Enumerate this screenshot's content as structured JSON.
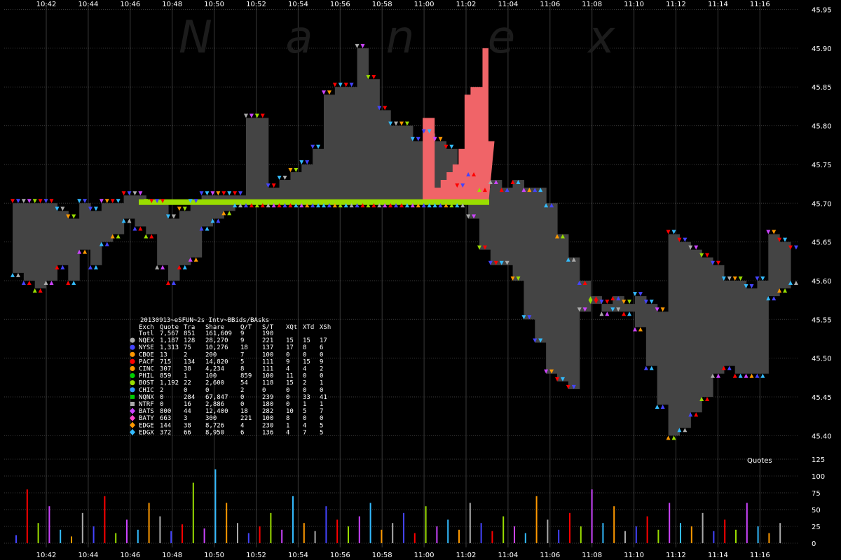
{
  "chart_data": {
    "type": "line",
    "watermark": "N a n e x",
    "x_ticks": [
      "10:42",
      "10:44",
      "10:46",
      "10:48",
      "10:50",
      "10:52",
      "10:54",
      "10:56",
      "10:58",
      "11:00",
      "11:02",
      "11:04",
      "11:06",
      "11:08",
      "11:10",
      "11:12",
      "11:14",
      "11:16"
    ],
    "price_axis": {
      "ticks": [
        "45.95",
        "45.90",
        "45.85",
        "45.80",
        "45.75",
        "45.70",
        "45.65",
        "45.60",
        "45.55",
        "45.50",
        "45.45",
        "45.40"
      ],
      "ylim": [
        45.375,
        45.955
      ]
    },
    "quotes_axis": {
      "label": "Quotes",
      "ticks": [
        "125",
        "100",
        "75",
        "50",
        "25",
        "0"
      ],
      "ylim": [
        0,
        125
      ]
    },
    "colors": {
      "gray_band": "#444444",
      "pink_area": "#f06468",
      "lime_line": "#99dd00",
      "grid": "#3a3a3a"
    },
    "bid_low": [
      45.61,
      45.6,
      45.59,
      45.6,
      45.62,
      45.6,
      45.64,
      45.62,
      45.65,
      45.66,
      45.68,
      45.67,
      45.66,
      45.62,
      45.6,
      45.62,
      45.63,
      45.67,
      45.68,
      45.69,
      45.7,
      45.7,
      45.7,
      45.7,
      45.7,
      45.7,
      45.7,
      45.7,
      45.7,
      45.7,
      45.7,
      45.7,
      45.7,
      45.7,
      45.7,
      45.7,
      45.7,
      45.7,
      45.7,
      45.7,
      45.7,
      45.74,
      45.72,
      45.73,
      45.72,
      45.73,
      45.72,
      45.72,
      45.7,
      45.66,
      45.63,
      45.6,
      45.58,
      45.56,
      45.58,
      45.56,
      45.54,
      45.49,
      45.44,
      45.4,
      45.41,
      45.43,
      45.45,
      45.48,
      45.49,
      45.48,
      45.48,
      45.48,
      45.58,
      45.59,
      45.6
    ],
    "ask_high": [
      45.7,
      45.7,
      45.7,
      45.7,
      45.69,
      45.68,
      45.7,
      45.69,
      45.7,
      45.7,
      45.71,
      45.71,
      45.7,
      45.7,
      45.68,
      45.69,
      45.7,
      45.71,
      45.71,
      45.71,
      45.71,
      45.81,
      45.81,
      45.72,
      45.73,
      45.74,
      45.75,
      45.77,
      45.84,
      45.85,
      45.85,
      45.9,
      45.86,
      45.82,
      45.8,
      45.8,
      45.78,
      45.79,
      45.78,
      45.77,
      45.72,
      45.68,
      45.64,
      45.62,
      45.62,
      45.6,
      45.55,
      45.52,
      45.48,
      45.47,
      45.46,
      45.56,
      45.57,
      45.57,
      45.56,
      45.57,
      45.58,
      45.57,
      45.56,
      45.66,
      45.65,
      45.64,
      45.63,
      45.62,
      45.6,
      45.6,
      45.59,
      45.6,
      45.66,
      45.65,
      45.64
    ],
    "pink_area": [
      45.7,
      45.7,
      45.7,
      45.7,
      45.7,
      45.7,
      45.7,
      45.7,
      45.7,
      45.7,
      45.7,
      45.7,
      45.7,
      45.7,
      45.7,
      45.7,
      45.7,
      45.7,
      45.7,
      45.7,
      45.7,
      45.81,
      45.81,
      45.72,
      45.73,
      45.74,
      45.75,
      45.77,
      45.84,
      45.85,
      45.85,
      45.9,
      45.78
    ],
    "quote_volume": [
      12,
      80,
      30,
      55,
      20,
      10,
      45,
      25,
      70,
      15,
      35,
      20,
      60,
      40,
      18,
      28,
      90,
      22,
      110,
      60,
      30,
      15,
      25,
      45,
      20,
      70,
      30,
      18,
      55,
      35,
      25,
      40,
      60,
      20,
      30,
      45,
      15,
      55,
      25,
      35,
      20,
      60,
      30,
      18,
      40,
      25,
      15,
      70,
      35,
      20,
      45,
      25,
      80,
      30,
      55,
      18,
      25,
      40,
      20,
      60,
      30,
      25,
      45,
      18,
      35,
      20,
      60,
      25,
      15,
      30
    ],
    "table": {
      "title": "20130913~eSFUN~2s Intv~BBids/BAsks",
      "columns": [
        "Exch",
        "Quote",
        "Tra",
        "Share",
        "Q/T",
        "S/T",
        "XQt",
        "XTd",
        "XSh"
      ],
      "rows": [
        {
          "exch": "Totl",
          "quote": "7,567",
          "tra": "851",
          "share": "161,609",
          "qt": "9",
          "st": "190",
          "xqt": "",
          "xtd": "",
          "xsh": "",
          "color": "",
          "shape": "none"
        },
        {
          "exch": "NQEX",
          "quote": "1,187",
          "tra": "128",
          "share": "28,270",
          "qt": "9",
          "st": "221",
          "xqt": "15",
          "xtd": "15",
          "xsh": "17",
          "color": "#aaaaaa",
          "shape": "circle"
        },
        {
          "exch": "NYSE",
          "quote": "1,313",
          "tra": "75",
          "share": "10,276",
          "qt": "18",
          "st": "137",
          "xqt": "17",
          "xtd": "8",
          "xsh": "6",
          "color": "#4444ff",
          "shape": "circle"
        },
        {
          "exch": "CBOE",
          "quote": "13",
          "tra": "2",
          "share": "200",
          "qt": "7",
          "st": "100",
          "xqt": "0",
          "xtd": "0",
          "xsh": "0",
          "color": "#ff9900",
          "shape": "circle"
        },
        {
          "exch": "PACF",
          "quote": "715",
          "tra": "134",
          "share": "14,820",
          "qt": "5",
          "st": "111",
          "xqt": "9",
          "xtd": "15",
          "xsh": "9",
          "color": "#ff0000",
          "shape": "circle"
        },
        {
          "exch": "CINC",
          "quote": "307",
          "tra": "38",
          "share": "4,234",
          "qt": "8",
          "st": "111",
          "xqt": "4",
          "xtd": "4",
          "xsh": "2",
          "color": "#ff9900",
          "shape": "circle"
        },
        {
          "exch": "PHIL",
          "quote": "859",
          "tra": "1",
          "share": "100",
          "qt": "859",
          "st": "100",
          "xqt": "11",
          "xtd": "0",
          "xsh": "0",
          "color": "#00cc00",
          "shape": "circle"
        },
        {
          "exch": "BOST",
          "quote": "1,192",
          "tra": "22",
          "share": "2,600",
          "qt": "54",
          "st": "118",
          "xqt": "15",
          "xtd": "2",
          "xsh": "1",
          "color": "#99dd00",
          "shape": "circle"
        },
        {
          "exch": "CHIC",
          "quote": "2",
          "tra": "0",
          "share": "0",
          "qt": "2",
          "st": "0",
          "xqt": "0",
          "xtd": "0",
          "xsh": "0",
          "color": "#3399ff",
          "shape": "circle"
        },
        {
          "exch": "NQNX",
          "quote": "0",
          "tra": "284",
          "share": "67,847",
          "qt": "0",
          "st": "239",
          "xqt": "0",
          "xtd": "33",
          "xsh": "41",
          "color": "#00cc00",
          "shape": "square"
        },
        {
          "exch": "NTRF",
          "quote": "0",
          "tra": "16",
          "share": "2,886",
          "qt": "0",
          "st": "180",
          "xqt": "0",
          "xtd": "1",
          "xsh": "1",
          "color": "#aaaaaa",
          "shape": "square"
        },
        {
          "exch": "BATS",
          "quote": "800",
          "tra": "44",
          "share": "12,400",
          "qt": "18",
          "st": "282",
          "xqt": "10",
          "xtd": "5",
          "xsh": "7",
          "color": "#cc44ff",
          "shape": "diamond"
        },
        {
          "exch": "BATY",
          "quote": "663",
          "tra": "3",
          "share": "300",
          "qt": "221",
          "st": "100",
          "xqt": "8",
          "xtd": "0",
          "xsh": "0",
          "color": "#ff44cc",
          "shape": "diamond"
        },
        {
          "exch": "EDGE",
          "quote": "144",
          "tra": "38",
          "share": "8,726",
          "qt": "4",
          "st": "230",
          "xqt": "1",
          "xtd": "4",
          "xsh": "5",
          "color": "#ff9900",
          "shape": "diamond"
        },
        {
          "exch": "EDGX",
          "quote": "372",
          "tra": "66",
          "share": "8,950",
          "qt": "6",
          "st": "136",
          "xqt": "4",
          "xtd": "7",
          "xsh": "5",
          "color": "#33bbff",
          "shape": "diamond"
        }
      ]
    }
  }
}
